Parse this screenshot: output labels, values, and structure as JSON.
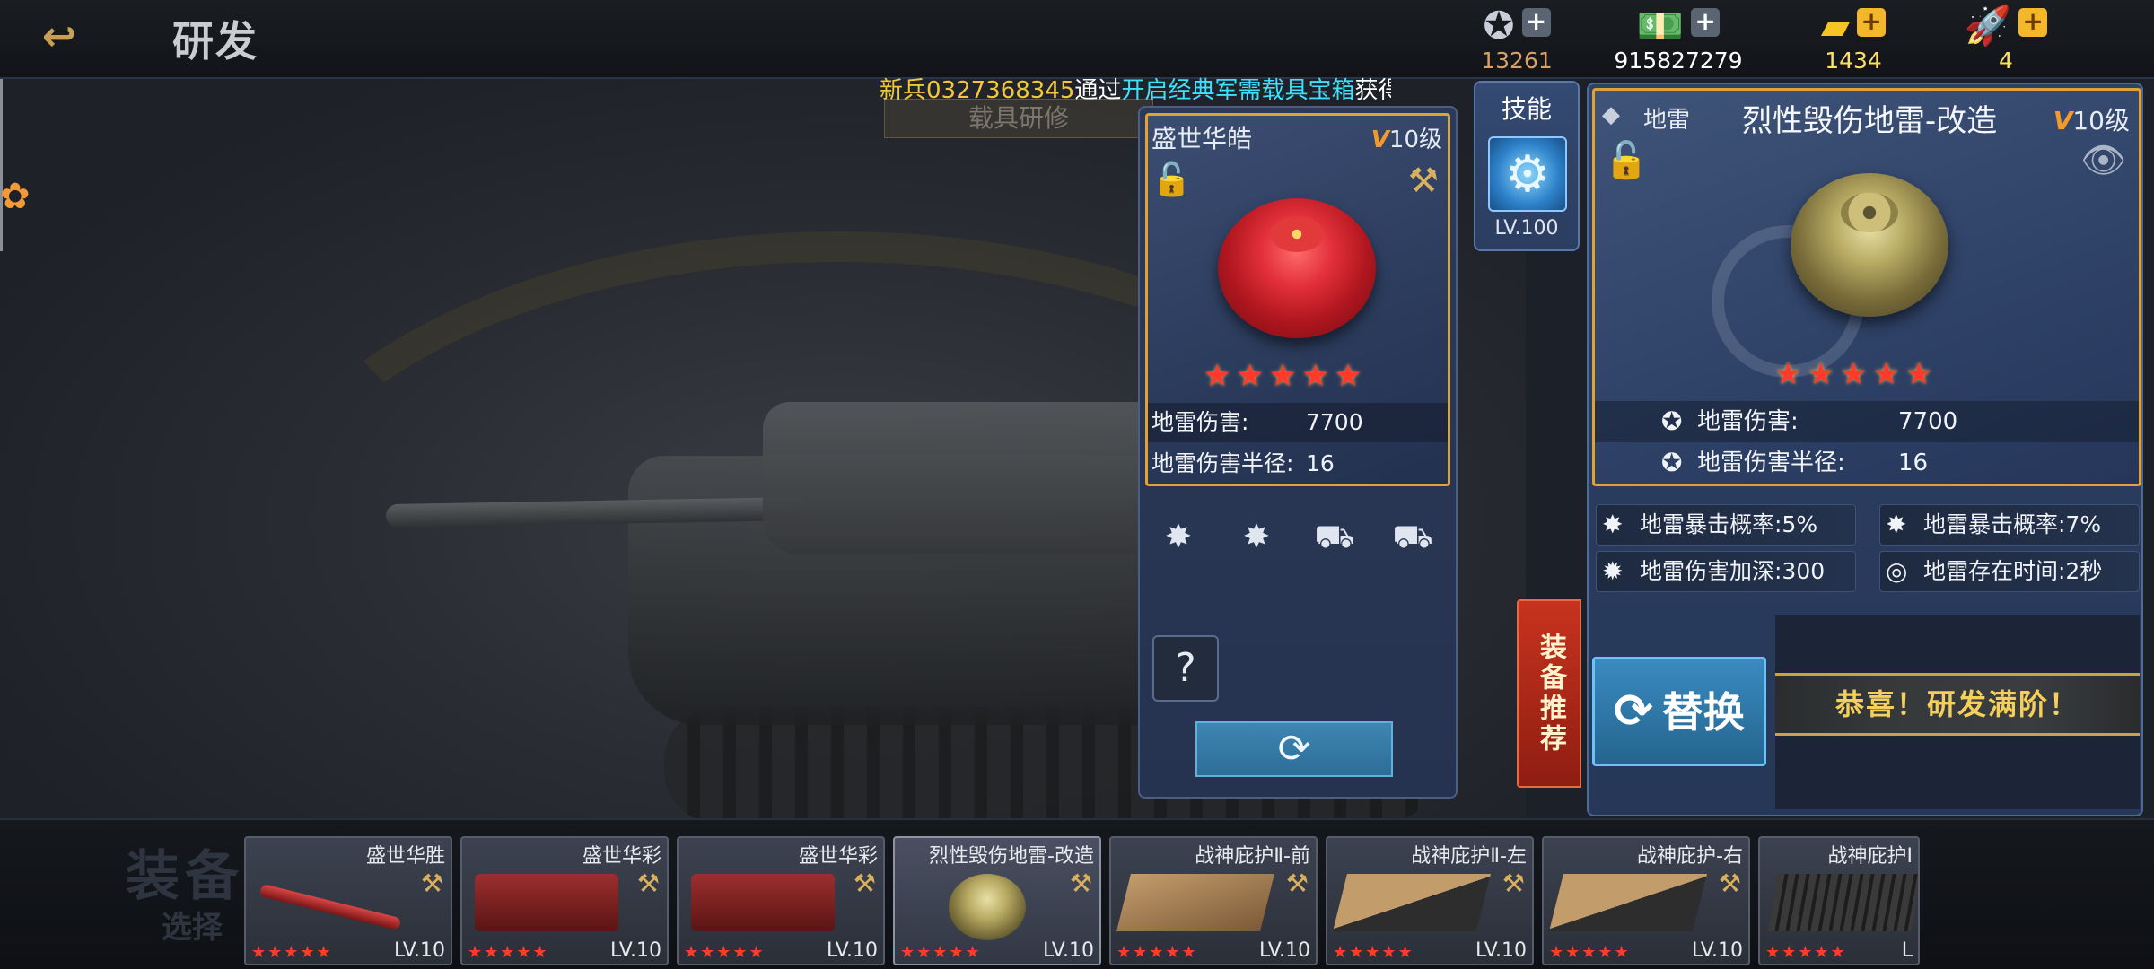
{
  "header": {
    "back_icon": "back-arrow-icon",
    "title": "研发",
    "currencies": [
      {
        "icon": "medal-icon",
        "glyph": "✪",
        "amount": "13261",
        "color": "#d9a16a",
        "plus": "+",
        "plus_style": "grey"
      },
      {
        "icon": "cash-icon",
        "glyph": "💵",
        "amount": "915827279",
        "color": "#ffffff",
        "plus": "+",
        "plus_style": "grey"
      },
      {
        "icon": "gold-bar-icon",
        "glyph": "▰",
        "amount": "1434",
        "color": "#ffe066",
        "plus": "+",
        "plus_style": "gold"
      },
      {
        "icon": "rocket-icon",
        "glyph": "🚀",
        "amount": "4",
        "color": "#ffe066",
        "plus": "+",
        "plus_style": "gold"
      }
    ]
  },
  "ticker": {
    "player": "新兵0327368345",
    "via": "通过",
    "box": "开启经典军需载具宝箱",
    "got": "获得"
  },
  "ghost_tab": "载具研修",
  "current": {
    "name": "盛世华皓",
    "level_v": "V",
    "level_text": "10级",
    "lock_icon": "unlock-icon",
    "hammer_icon": "hammer-icon",
    "stars": "★★★★★",
    "stats": [
      {
        "label": "地雷伤害:",
        "value": "7700"
      },
      {
        "label": "地雷伤害半径:",
        "value": "16"
      }
    ],
    "skill_slots": [
      "crit-burst-icon",
      "crit-burst-icon",
      "tank-boost-icon",
      "tank-boost-icon"
    ],
    "help_label": "?",
    "refresh_glyph": "⟳"
  },
  "skill_tab": {
    "title": "技能",
    "badge_glyph": "⚙",
    "level": "LV.100"
  },
  "recommend": "装备推荐",
  "detail": {
    "category": "地雷",
    "name": "烈性毁伤地雷-改造",
    "level_v": "V",
    "level_text": "10级",
    "stars": "★★★★★",
    "stats": [
      {
        "icon": "mine-damage-icon",
        "label": "地雷伤害:",
        "value": "7700"
      },
      {
        "icon": "mine-radius-icon",
        "label": "地雷伤害半径:",
        "value": "16"
      }
    ],
    "attributes": [
      {
        "icon": "crit-burst-icon",
        "label": "地雷暴击概率:5%"
      },
      {
        "icon": "crit-burst-icon",
        "label": "地雷暴击概率:7%"
      },
      {
        "icon": "explosion-icon",
        "label": "地雷伤害加深:300"
      },
      {
        "icon": "timer-ring-icon",
        "label": "地雷存在时间:2秒"
      }
    ],
    "replace_label": "替换",
    "max_message": "恭喜！研发满阶！"
  },
  "bottom": {
    "title": "装备",
    "subtitle": "选择",
    "slots": [
      {
        "name": "盛世华胜",
        "stars": "★★★★★",
        "level": "LV.10",
        "art": "art-barrel"
      },
      {
        "name": "盛世华彩",
        "stars": "★★★★★",
        "level": "LV.10",
        "art": "art-gun"
      },
      {
        "name": "盛世华彩",
        "stars": "★★★★★",
        "level": "LV.10",
        "art": "art-gun"
      },
      {
        "name": "烈性毁伤地雷-改造",
        "stars": "★★★★★",
        "level": "LV.10",
        "art": "art-mine"
      },
      {
        "name": "战神庇护Ⅱ-前",
        "stars": "★★★★★",
        "level": "LV.10",
        "art": "art-armor"
      },
      {
        "name": "战神庇护Ⅱ-左",
        "stars": "★★★★★",
        "level": "LV.10",
        "art": "art-armor-dark"
      },
      {
        "name": "战神庇护-右",
        "stars": "★★★★★",
        "level": "LV.10",
        "art": "art-armor-dark"
      },
      {
        "name": "战神庇护Ⅰ",
        "stars": "★★★★★",
        "level": "L",
        "art": "art-grid"
      }
    ]
  }
}
